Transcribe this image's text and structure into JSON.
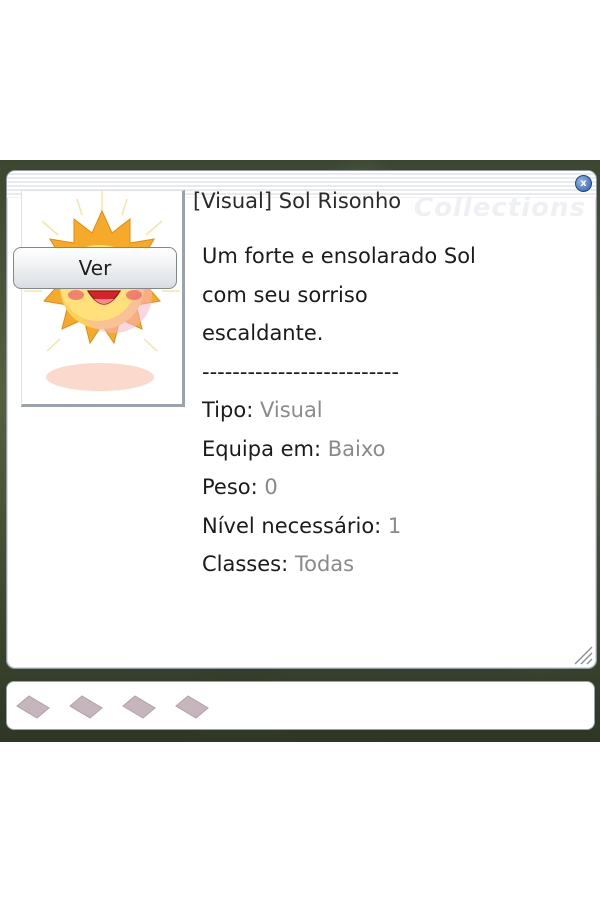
{
  "window": {
    "watermark": "Collections",
    "close_glyph": "x",
    "close_icon": "close-icon"
  },
  "item": {
    "title": "[Visual] Sol Risonho",
    "image_icon": "smiling-sun-icon",
    "view_button_label": "Ver",
    "description": [
      "Um forte e ensolarado Sol",
      "com seu sorriso",
      "escaldante."
    ],
    "separator": "--------------------------",
    "attributes": [
      {
        "label": "Tipo: ",
        "value": "Visual"
      },
      {
        "label": "Equipa em: ",
        "value": "Baixo"
      },
      {
        "label": "Peso: ",
        "value": "0"
      },
      {
        "label": "Nível necessário: ",
        "value": "1"
      },
      {
        "label": "Classes: ",
        "value": "Todas"
      }
    ]
  },
  "card_slots": {
    "count": 4,
    "icon": "card-slot-icon",
    "color": "#c7b5bd"
  },
  "colors": {
    "value_text": "#8a8a8a",
    "window_border": "#8f9aa6",
    "close_button": "#2f5fae"
  }
}
